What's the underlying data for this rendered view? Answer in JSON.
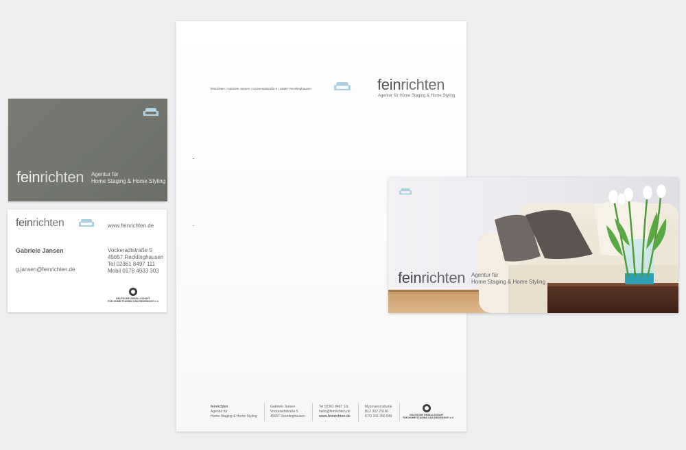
{
  "card_front": {
    "logo_bold": "fein",
    "logo_light": "richten",
    "tagline_line1": "Agentur für",
    "tagline_line2": "Home Staging & Home Styling",
    "icon": "sofa-icon"
  },
  "card_back": {
    "logo_bold": "fein",
    "logo_light": "richten",
    "website": "www.feinrichten.de",
    "name": "Gabriele Jansen",
    "email": "g.jansen@feinrichten.de",
    "street": "Vockeradtstraße 5",
    "city": "45657 Recklinghausen",
    "tel": "Tel 02361 8497 111",
    "mobile": "Mobil 0178 4933 303",
    "seal_line1": "DEUTSCHE GESELLSCHAFT",
    "seal_line2": "FÜR HOME STAGING UND REDESIGN® e.V.",
    "icon": "sofa-icon"
  },
  "letterhead": {
    "sender_line": "feinrichten  |  Gabriele Jansen  |  Vockeradtstraße 5  |  45657 Recklinghausen",
    "logo_bold": "fein",
    "logo_light": "richten",
    "subtitle": "Agentur für Home Staging & Home Styling",
    "footer": {
      "col1": [
        "feinrichten",
        "Agentur für",
        "Home Staging & Home Styling"
      ],
      "col2": [
        "Gabriele Jansen",
        "Vockeradtstraße 5",
        "45657 Recklinghausen"
      ],
      "col3": [
        "Tel 02361 8497 111",
        "hallo@feinrichten.de",
        "www.feinrichten.de"
      ],
      "col4": [
        "Mypovereinsbank",
        "BLZ  302 20190",
        "KTO  341 356 849"
      ],
      "seal_line1": "DEUTSCHE GESELLSCHAFT",
      "seal_line2": "FÜR HOME STAGING UND REDESIGN® e.V."
    },
    "icon": "sofa-icon"
  },
  "flyer": {
    "logo_bold": "fein",
    "logo_light": "richten",
    "tagline_line1": "Agentur für",
    "tagline_line2": "Home Staging & Home Styling",
    "icon": "sofa-icon"
  },
  "colors": {
    "background": "#eeeff1",
    "card_front": "#767972",
    "sofa_icon": "#a9cfe0",
    "text_dark": "#4d5153"
  }
}
